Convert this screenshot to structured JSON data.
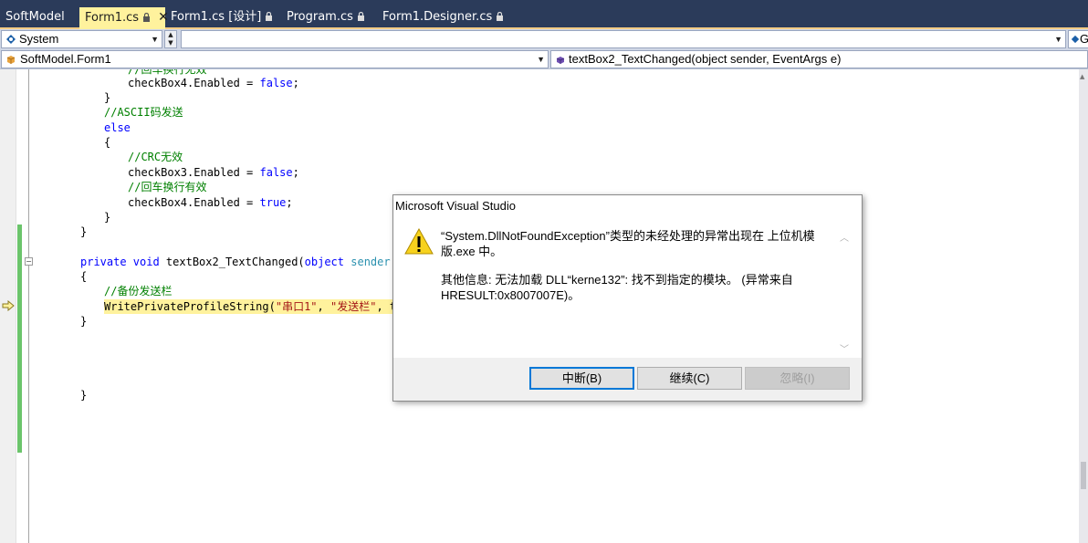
{
  "tabs": [
    {
      "label": "SoftModel"
    },
    {
      "label": "Form1.cs",
      "active": true
    },
    {
      "label": "Form1.cs [设计]"
    },
    {
      "label": "Program.cs"
    },
    {
      "label": "Form1.Designer.cs"
    }
  ],
  "project_combo": {
    "value": "System"
  },
  "right_combo_fragment": "G",
  "class_combo": {
    "value": "SoftModel.Form1"
  },
  "member_combo": {
    "value": "textBox2_TextChanged(object sender, EventArgs e)"
  },
  "code": {
    "l0": "//回车换行无效",
    "l1a": "checkBox4.Enabled = ",
    "l1b": "false",
    "l2": "}",
    "l3": "//ASCII码发送",
    "l4": "else",
    "l5": "{",
    "l6": "//CRC无效",
    "l7a": "checkBox3.Enabled = ",
    "l7b": "false",
    "l8": "//回车换行有效",
    "l9a": "checkBox4.Enabled = ",
    "l9b": "true",
    "l10": "}",
    "l11": "}",
    "l12a": "private void",
    "l12b": " textBox2_TextChanged(",
    "l12c": "object",
    "l12d": " sender, Even",
    "l13": "{",
    "l14": "//备份发送栏",
    "l15a": "WritePrivateProfileString(",
    "l15b": "\"串口1\"",
    "l15c": ", ",
    "l15d": "\"发送栏\"",
    "l15e": ", textB",
    "l16": "}",
    "l17": "}"
  },
  "dialog": {
    "title": "Microsoft Visual Studio",
    "message": "“System.DllNotFoundException”类型的未经处理的异常出现在 上位机模版.exe 中。",
    "detail": "其他信息: 无法加载 DLL“kerne132”: 找不到指定的模块。 (异常来自 HRESULT:0x8007007E)。",
    "buttons": {
      "break": "中断(B)",
      "continue": "继续(C)",
      "ignore": "忽略(I)"
    }
  },
  "colors": {
    "tab_bar": "#2b3b5a",
    "active_tab": "#fff29d",
    "keyword": "#0000ff",
    "comment": "#008000",
    "string": "#a31515",
    "change_bar": "#6bc46b"
  }
}
